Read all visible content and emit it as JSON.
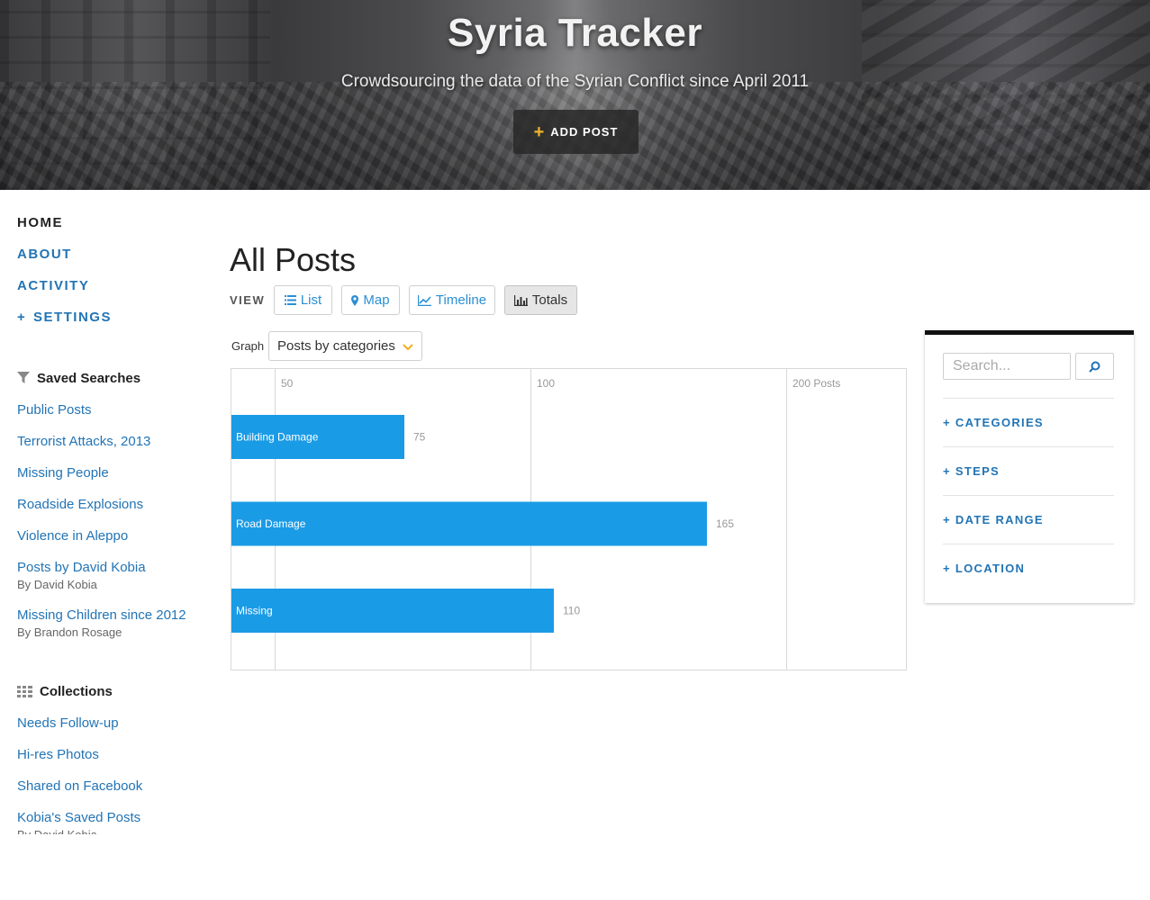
{
  "header": {
    "title": "Syria Tracker",
    "subtitle": "Crowdsourcing the data of the Syrian Conflict since April 2011",
    "add_post_label": "ADD POST"
  },
  "nav": {
    "home": "HOME",
    "about": "ABOUT",
    "activity": "ACTIVITY",
    "settings": "SETTINGS"
  },
  "saved_searches": {
    "heading": "Saved Searches",
    "items": [
      {
        "label": "Public Posts",
        "by": ""
      },
      {
        "label": "Terrorist Attacks, 2013",
        "by": ""
      },
      {
        "label": "Missing People",
        "by": ""
      },
      {
        "label": "Roadside Explosions",
        "by": ""
      },
      {
        "label": "Violence in Aleppo",
        "by": ""
      },
      {
        "label": "Posts by David Kobia",
        "by": "By David Kobia"
      },
      {
        "label": "Missing Children since 2012",
        "by": "By Brandon Rosage"
      }
    ]
  },
  "collections": {
    "heading": "Collections",
    "items": [
      {
        "label": "Needs Follow-up",
        "by": ""
      },
      {
        "label": "Hi-res Photos",
        "by": ""
      },
      {
        "label": "Shared on Facebook",
        "by": ""
      },
      {
        "label": "Kobia's Saved Posts",
        "by": "By David Kobia"
      }
    ]
  },
  "main": {
    "title": "All Posts",
    "view_label": "VIEW",
    "views": {
      "list": "List",
      "map": "Map",
      "timeline": "Timeline",
      "totals": "Totals"
    },
    "active_view": "totals",
    "graph_label": "Graph",
    "graph_selected": "Posts by categories"
  },
  "chart_data": {
    "type": "bar",
    "orientation": "horizontal",
    "categories": [
      "Building Damage",
      "Road Damage",
      "Missing"
    ],
    "values": [
      75,
      165,
      110
    ],
    "tick_labels": [
      "50",
      "100",
      "200 Posts"
    ],
    "bar_color": "#1a9be6",
    "grid": true
  },
  "filters": {
    "search_placeholder": "Search...",
    "items": [
      "CATEGORIES",
      "STEPS",
      "DATE RANGE",
      "LOCATION"
    ]
  },
  "colors": {
    "link": "#2274b5",
    "accent_plus": "#f0b429",
    "button_text": "#2a8fd4"
  }
}
